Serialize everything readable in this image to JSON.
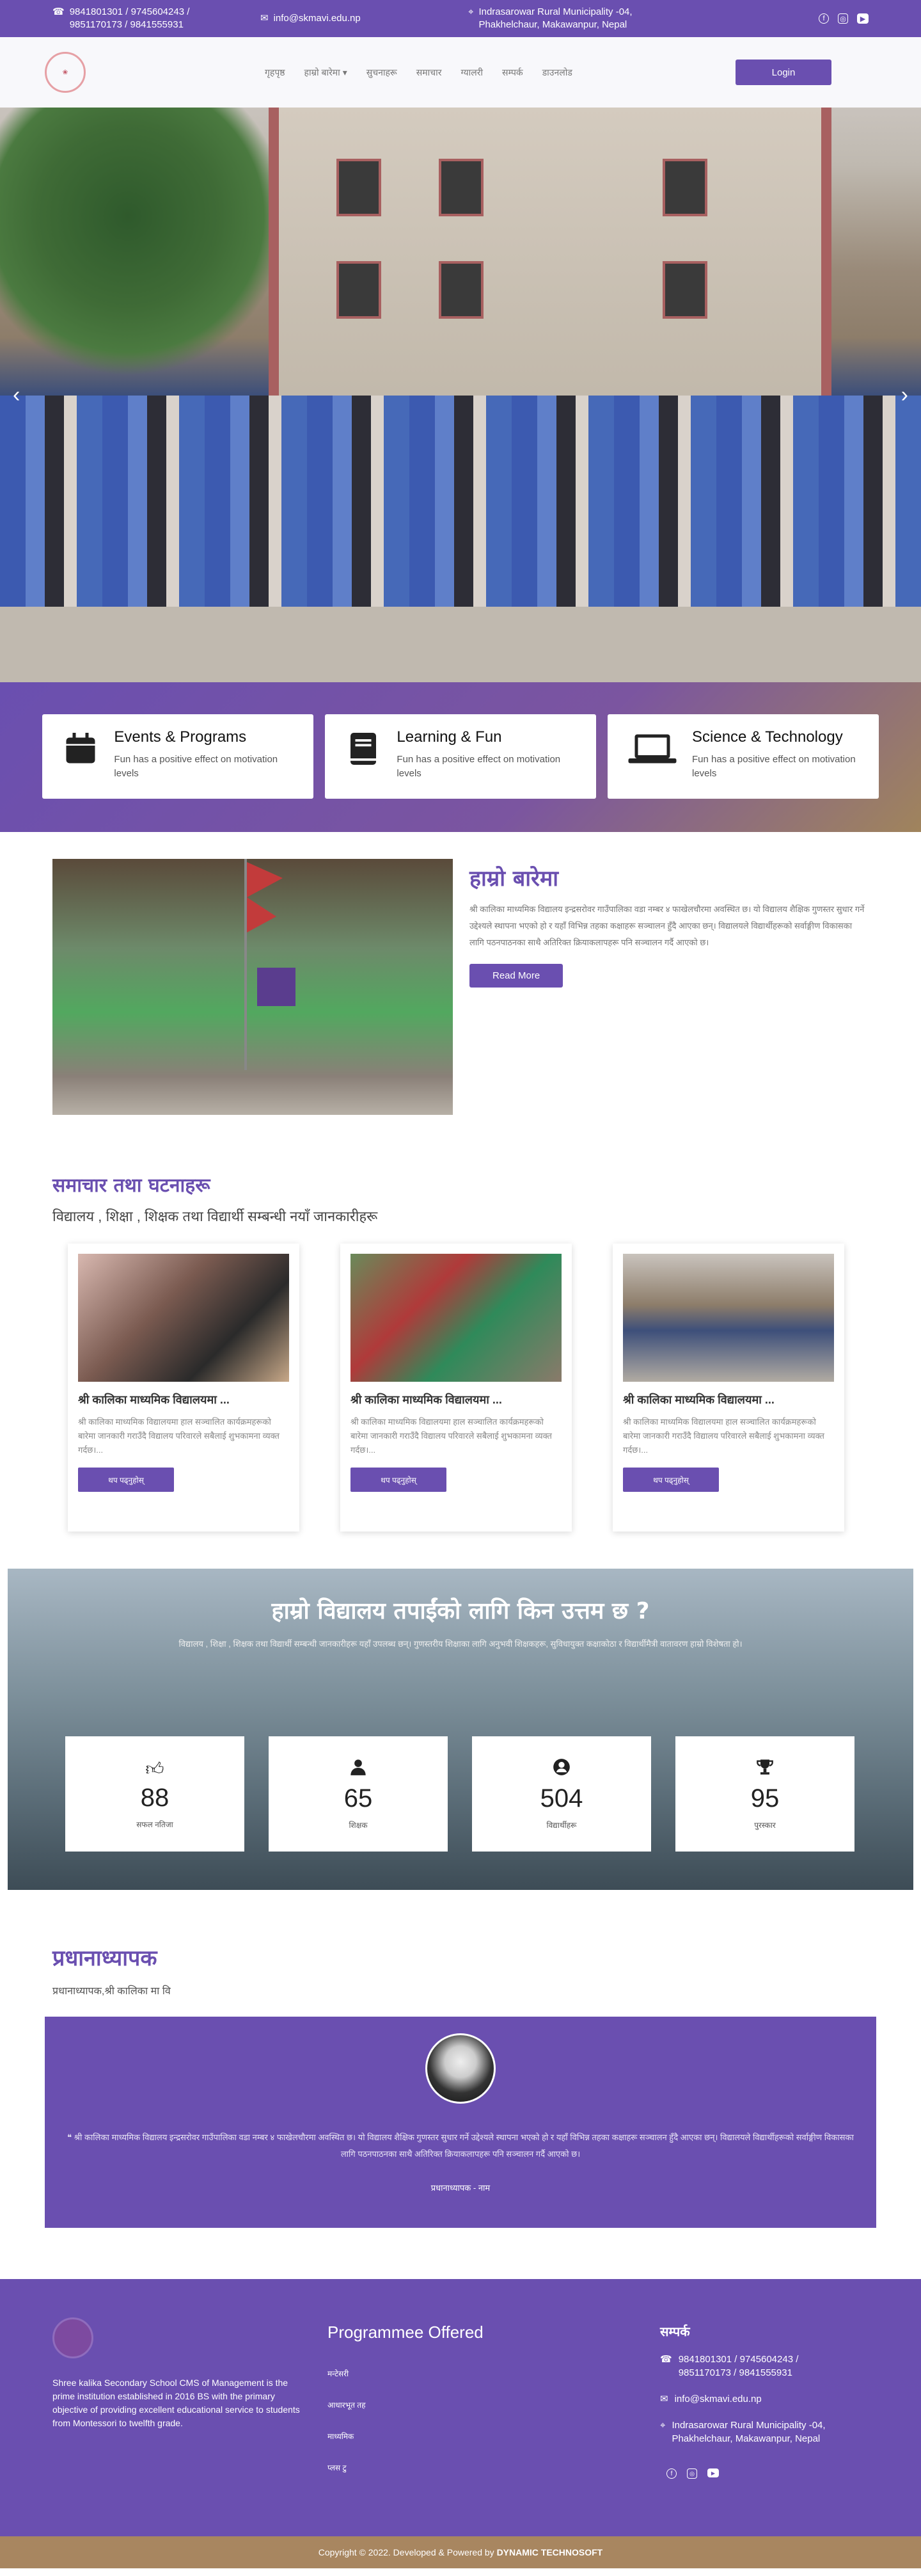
{
  "topbar": {
    "phone": "9841801301 / 9745604243 / 9851170173 / 9841555931",
    "email": "info@skmavi.edu.np",
    "address": "Indrasarowar Rural Municipality -04, Phakhelchaur, Makawanpur, Nepal",
    "social": [
      "facebook-icon",
      "instagram-icon",
      "youtube-icon"
    ]
  },
  "nav": {
    "items": [
      "गृहपृष्ठ",
      "हाम्रो बारेमा",
      "सुचनाहरू",
      "समाचार",
      "ग्यालरी",
      "सम्पर्क",
      "डाउनलोड"
    ],
    "login": "Login"
  },
  "hero": {
    "prev": "‹",
    "next": "›"
  },
  "features": [
    {
      "icon": "calendar-icon",
      "title": "Events & Programs",
      "text": "Fun has a positive effect on motivation levels"
    },
    {
      "icon": "book-icon",
      "title": "Learning & Fun",
      "text": "Fun has a positive effect on motivation levels"
    },
    {
      "icon": "laptop-icon",
      "title": "Science & Technology",
      "text": "Fun has a positive effect on motivation levels"
    }
  ],
  "about": {
    "title": "हाम्रो बारेमा",
    "text": "श्री कालिका माध्यमिक विद्यालय इन्द्रसरोवर गाउँपालिका वडा नम्बर ४ फाखेलचौरमा अवस्थित छ। यो विद्यालय शैक्षिक गुणस्तर सुधार गर्ने उद्देश्यले स्थापना भएको हो र यहाँ विभिन्न तहका कक्षाहरू सञ्चालन हुँदै आएका छन्। विद्यालयले विद्यार्थीहरूको सर्वाङ्गीण विकासका लागि पठनपाठनका साथै अतिरिक्त क्रियाकलापहरू पनि सञ्चालन गर्दै आएको छ।",
    "button": "Read More"
  },
  "news": {
    "title": "समाचार तथा घटनाहरू",
    "subtitle": "विद्यालय , शिक्षा , शिक्षक तथा विद्यार्थी सम्बन्धी नयाँ जानकारीहरू",
    "cards": [
      {
        "title": "श्री कालिका माध्यमिक विद्यालयमा ...",
        "text": "श्री कालिका माध्यमिक विद्यालयमा हाल सञ्चालित कार्यक्रमहरूको बारेमा जानकारी गराउँदै विद्यालय परिवारले सबैलाई शुभकामना व्यक्त गर्दछ।...",
        "button": "थप पढ्नुहोस्"
      },
      {
        "title": "श्री कालिका माध्यमिक विद्यालयमा ...",
        "text": "श्री कालिका माध्यमिक विद्यालयमा हाल सञ्चालित कार्यक्रमहरूको बारेमा जानकारी गराउँदै विद्यालय परिवारले सबैलाई शुभकामना व्यक्त गर्दछ।...",
        "button": "थप पढ्नुहोस्"
      },
      {
        "title": "श्री कालिका माध्यमिक विद्यालयमा ...",
        "text": "श्री कालिका माध्यमिक विद्यालयमा हाल सञ्चालित कार्यक्रमहरूको बारेमा जानकारी गराउँदै विद्यालय परिवारले सबैलाई शुभकामना व्यक्त गर्दछ।...",
        "button": "थप पढ्नुहोस्"
      }
    ]
  },
  "stats": {
    "title": "हाम्रो विद्यालय तपाईंको लागि किन उत्तम छ ?",
    "text": "विद्यालय , शिक्षा , शिक्षक तथा विद्यार्थी सम्बन्धी जानकारीहरू यहाँ उपलब्ध छन्। गुणस्तरीय शिक्षाका लागि अनुभवी शिक्षकहरू, सुविधायुक्त कक्षाकोठा र विद्यार्थीमैत्री वातावरण हाम्रो विशेषता हो।",
    "items": [
      {
        "icon": "thumbs-up-icon",
        "value": "88",
        "label": "सफल नतिजा"
      },
      {
        "icon": "user-icon",
        "value": "65",
        "label": "शिक्षक"
      },
      {
        "icon": "user-circle-icon",
        "value": "504",
        "label": "विद्यार्थीहरू"
      },
      {
        "icon": "trophy-icon",
        "value": "95",
        "label": "पुरस्कार"
      }
    ]
  },
  "testimonial": {
    "title": "प्रधानाध्यापक",
    "subtitle": "प्रधानाध्यापक,श्री कालिका मा वि",
    "quote": "श्री कालिका माध्यमिक विद्यालय इन्द्रसरोवर गाउँपालिका वडा नम्बर ४ फाखेलचौरमा अवस्थित छ। यो विद्यालय शैक्षिक गुणस्तर सुधार गर्ने उद्देश्यले स्थापना भएको हो र यहाँ विभिन्न तहका कक्षाहरू सञ्चालन हुँदै आएका छन्। विद्यालयले विद्यार्थीहरूको सर्वाङ्गीण विकासका लागि पठनपाठनका साथै अतिरिक्त क्रियाकलापहरू पनि सञ्चालन गर्दै आएको छ।",
    "who": "प्रधानाध्यापक - नाम"
  },
  "footer": {
    "about": "Shree kalika Secondary School CMS of Management is the prime institution established in 2016 BS with the primary objective of providing excellent educational service to students from Montessori to twelfth grade.",
    "programs_title": "Programmee Offered",
    "programs": [
      "मन्टेसरी",
      "आधारभूत तह",
      "माध्यमिक",
      "प्लस टु"
    ],
    "contact_title": "सम्पर्क",
    "phone": "9841801301 / 9745604243 / 9851170173 / 9841555931",
    "email": "info@skmavi.edu.np",
    "address": "Indrasarowar Rural Municipality -04, Phakhelchaur, Makawanpur, Nepal"
  },
  "copyright": {
    "text": "Copyright © 2022. Developed & Powered by",
    "brand": "DYNAMIC TECHNOSOFT"
  }
}
